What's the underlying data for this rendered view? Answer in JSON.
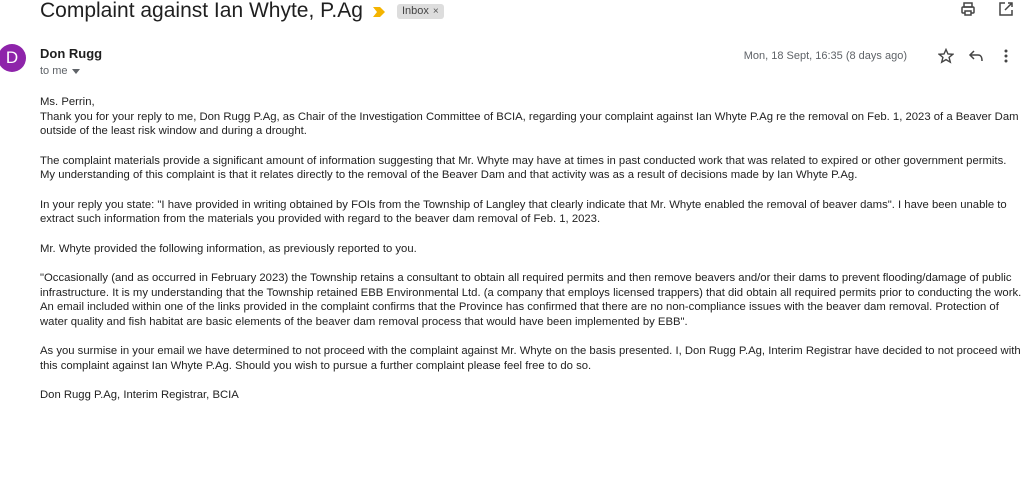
{
  "email": {
    "subject": "Complaint against Ian Whyte, P.Ag",
    "label": "Inbox",
    "label_remove": "×",
    "sender_initial": "D",
    "sender_name": "Don Rugg",
    "recipient": "to me",
    "date": "Mon, 18 Sept, 16:35 (8 days ago)",
    "body": {
      "greeting": "Ms. Perrin,",
      "p1": "Thank you for your reply to me, Don Rugg P.Ag, as Chair of the Investigation Committee of BCIA, regarding your complaint against Ian Whyte P.Ag re the removal on Feb. 1, 2023 of a Beaver Dam outside of the least risk window and during a drought.",
      "p2": "The complaint materials provide a significant amount of information suggesting that Mr. Whyte may have at times in past conducted work that was related to expired or other government permits.  My understanding of this complaint is that it relates directly to the removal of the Beaver Dam and that activity was as a result of decisions made by Ian Whyte P.Ag.",
      "p3": "In your reply you state: \"I have provided in writing obtained by FOIs from the Township of Langley that clearly indicate that Mr. Whyte enabled the removal of beaver dams\". I have been unable to extract such information from the materials you provided with regard to the beaver dam removal of Feb. 1, 2023.",
      "p4": "Mr. Whyte provided the following information, as previously reported to you.",
      "p5": "\"Occasionally (and as occurred in February 2023) the Township retains a consultant to obtain all required permits and then remove beavers and/or their dams to prevent flooding/damage of public infrastructure.  It is my understanding that the Township retained EBB Environmental Ltd. (a company that employs licensed trappers) that did obtain all required permits prior to conducting the work.  An email included within one of the links provided in the complaint confirms that the Province has confirmed that there are no non-compliance issues with the beaver dam removal.  Protection of water quality and fish habitat are basic elements of the beaver dam removal process that would have been implemented by EBB\".",
      "p6": "As you surmise in your email we have determined to not proceed with the complaint against Mr. Whyte on the basis presented.  I, Don Rugg P.Ag, Interim Registrar have decided to not proceed with this complaint against Ian Whyte P.Ag. Should you wish to pursue a further complaint please feel free to do so.",
      "signature": "Don Rugg P.Ag, Interim Registrar, BCIA"
    }
  },
  "icons": {
    "importance": "importance-marker-icon",
    "print": "print-icon",
    "open_new_window": "open-in-new-window-icon",
    "star": "star-icon",
    "reply": "reply-icon",
    "more": "more-vert-icon",
    "caret": "chevron-down-icon"
  },
  "colors": {
    "avatar": "#8e24aa",
    "importance": "#f4b400",
    "label_chip": "#dddddd"
  }
}
